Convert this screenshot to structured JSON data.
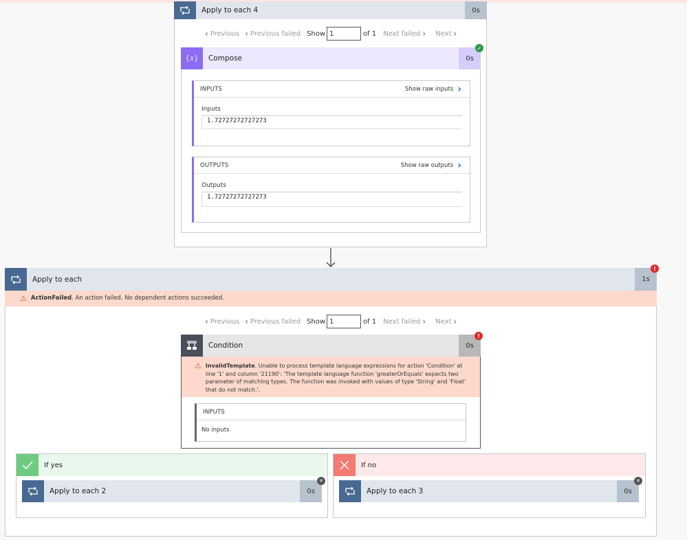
{
  "apply_each_4": {
    "title": "Apply to each 4",
    "duration": "0s",
    "pager": {
      "previous": "Previous",
      "previous_failed": "Previous failed",
      "show": "Show",
      "current": "1",
      "of": "of 1",
      "next_failed": "Next failed",
      "next": "Next"
    },
    "compose": {
      "title": "Compose",
      "duration": "0s",
      "status": "succeeded",
      "inputs_section": {
        "header": "INPUTS",
        "raw_link": "Show raw inputs",
        "field_label": "Inputs",
        "field_value": "1.72727272727273"
      },
      "outputs_section": {
        "header": "OUTPUTS",
        "raw_link": "Show raw outputs",
        "field_label": "Outputs",
        "field_value": "1.72727272727273"
      }
    }
  },
  "apply_each": {
    "title": "Apply to each",
    "duration": "1s",
    "status": "failed",
    "alert_code": "ActionFailed",
    "alert_message": ". An action failed. No dependent actions succeeded.",
    "pager": {
      "previous": "Previous",
      "previous_failed": "Previous failed",
      "show": "Show",
      "current": "1",
      "of": "of 1",
      "next_failed": "Next failed",
      "next": "Next"
    },
    "condition": {
      "title": "Condition",
      "duration": "0s",
      "status": "failed",
      "alert_code": "InvalidTemplate",
      "alert_message": ". Unable to process template language expressions for action 'Condition' at line '1' and column '21190': 'The template language function 'greaterOrEquals' expects two parameter of matching types. The function was invoked with values of type 'String' and 'Float' that do not match.'.",
      "inputs_header": "INPUTS",
      "inputs_empty": "No inputs"
    },
    "if_yes": {
      "label": "If yes",
      "action_title": "Apply to each 2",
      "action_duration": "0s",
      "action_status": "skipped"
    },
    "if_no": {
      "label": "If no",
      "action_title": "Apply to each 3",
      "action_duration": "0s",
      "action_status": "skipped"
    }
  },
  "icons": {
    "loop": "loop-icon",
    "compose": "compose-icon",
    "condition": "condition-icon",
    "check": "checkmark-icon",
    "cross": "cross-icon",
    "warning": "warning-icon"
  },
  "colors": {
    "loop_icon_bg": "#486991",
    "loop_header_bg": "#e1e6ed",
    "compose_icon_bg": "#8c6cf0",
    "compose_header_bg": "#ede8fd",
    "condition_icon_bg": "#484f58",
    "alert_bg": "#fcd9cc",
    "success": "#2a9d4a",
    "error": "#e02929",
    "yes_bg": "#e9f7ec",
    "no_bg": "#fde9e9"
  }
}
